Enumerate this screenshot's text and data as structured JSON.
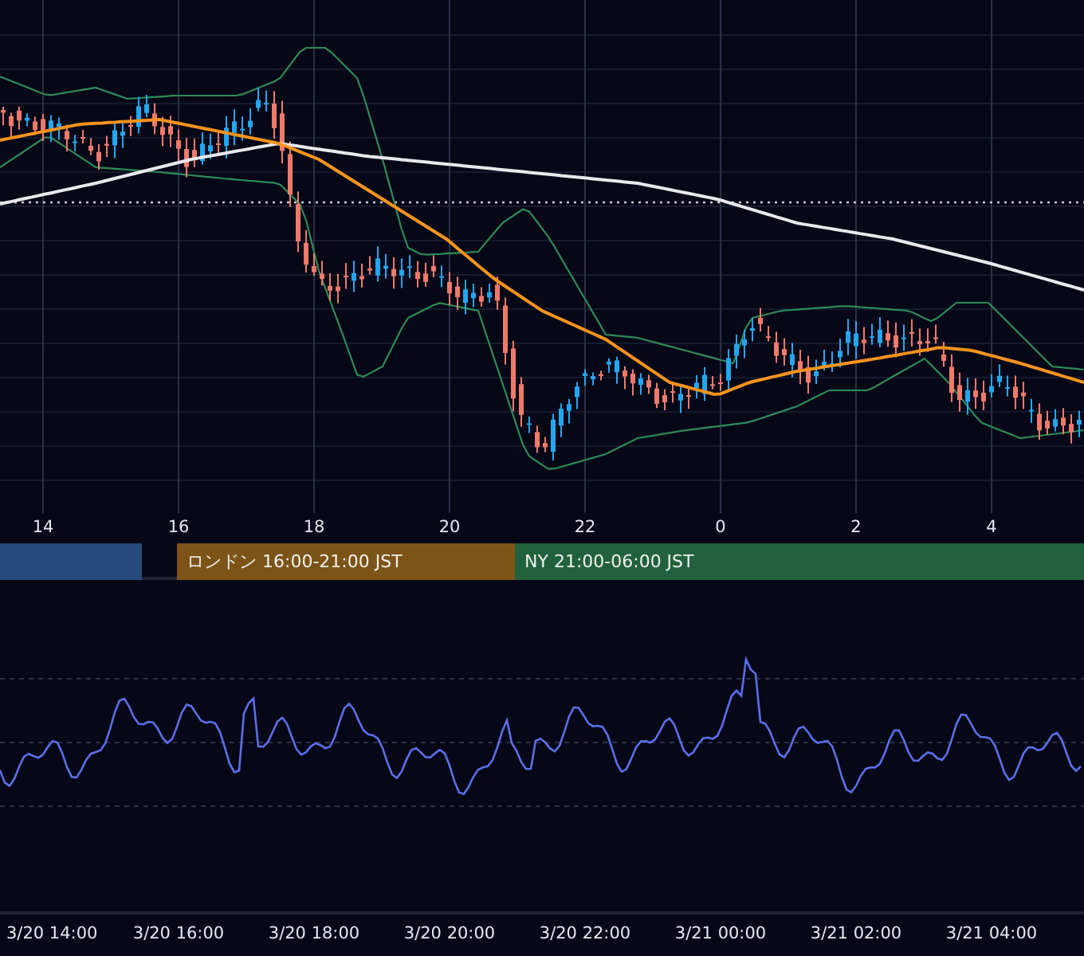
{
  "price_chart": {
    "kind": "candlestick"
  },
  "hour_axis": [
    "14",
    "16",
    "18",
    "20",
    "22",
    "0",
    "2",
    "4"
  ],
  "sessions": [
    {
      "color": "#24497a"
    },
    {
      "label": "ロンドン 16:00-21:00 JST",
      "color": "#7d5417"
    },
    {
      "label": "NY 21:00-06:00 JST",
      "color": "#22613d"
    }
  ],
  "oscillator": {
    "kind": "line"
  },
  "time_axis": [
    "3/20 14:00",
    "3/20 16:00",
    "3/20 18:00",
    "3/20 20:00",
    "3/20 22:00",
    "3/21 00:00",
    "3/21 02:00",
    "3/21 04:00"
  ]
}
